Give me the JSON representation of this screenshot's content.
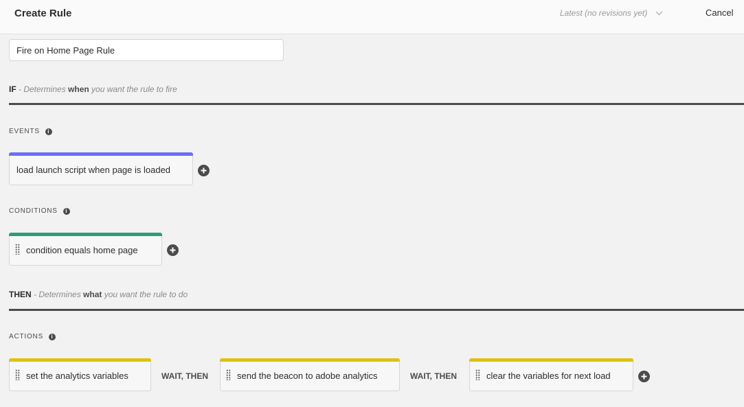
{
  "header": {
    "title": "Create Rule",
    "revision": "Latest (no revisions yet)",
    "cancel": "Cancel"
  },
  "rule_name": {
    "value": "Fire on Home Page Rule"
  },
  "if_section": {
    "keyword": "IF",
    "prefix": " - Determines ",
    "emphasis": "when",
    "suffix": " you want the rule to fire"
  },
  "then_section": {
    "keyword": "THEN",
    "prefix": " - Determines ",
    "emphasis": "what",
    "suffix": " you want the rule to do"
  },
  "events": {
    "label": "EVENTS",
    "items": [
      {
        "label": "load launch script when page is loaded"
      }
    ],
    "accent": "#6e6ef5"
  },
  "conditions": {
    "label": "CONDITIONS",
    "items": [
      {
        "label": "condition equals home page"
      }
    ],
    "accent": "#2d9d78"
  },
  "actions": {
    "label": "ACTIONS",
    "items": [
      {
        "label": "set the analytics variables"
      },
      {
        "label": "send the beacon to adobe analytics"
      },
      {
        "label": "clear the variables for next load"
      }
    ],
    "connector": "WAIT, THEN",
    "accent": "#e0c210"
  },
  "icons": {
    "info": "info-icon",
    "add": "plus-circle-icon",
    "chevron": "chevron-down-icon",
    "grip": "drag-handle-icon"
  }
}
